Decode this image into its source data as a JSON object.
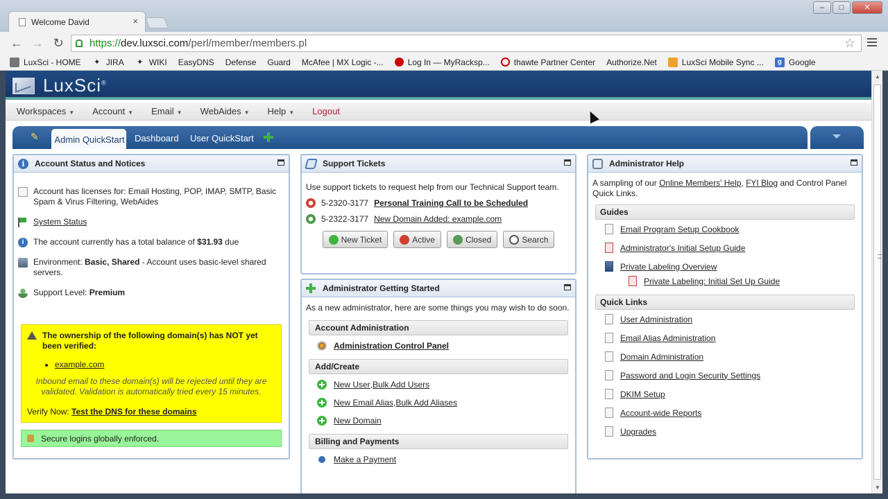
{
  "browser": {
    "tab_title": "Welcome David",
    "tab_close": "×",
    "url_scheme": "https://",
    "url_host": "dev.luxsci.com",
    "url_path": "/perl/member/members.pl",
    "window_controls": {
      "minimize": "–",
      "maximize": "□",
      "close": "✕"
    },
    "bookmarks": [
      {
        "label": "LuxSci - HOME",
        "icon": "page-icon"
      },
      {
        "label": "JIRA",
        "icon": "jira-icon"
      },
      {
        "label": "WIKI",
        "icon": "wiki-icon"
      },
      {
        "label": "EasyDNS",
        "icon": "page-icon"
      },
      {
        "label": "Defense",
        "icon": "page-icon"
      },
      {
        "label": "Guard",
        "icon": "page-icon"
      },
      {
        "label": "McAfee | MX Logic -...",
        "icon": "page-icon"
      },
      {
        "label": "Log In — MyRacksp...",
        "icon": "rackspace-icon"
      },
      {
        "label": "thawte Partner Center",
        "icon": "thawte-icon"
      },
      {
        "label": "Authorize.Net",
        "icon": "page-icon"
      },
      {
        "label": "LuxSci Mobile Sync ...",
        "icon": "luxsci-icon"
      },
      {
        "label": "Google",
        "icon": "google-icon"
      }
    ]
  },
  "app": {
    "logo": "LuxSci",
    "logo_mark": "®",
    "menu": [
      {
        "label": "Workspaces",
        "caret": true
      },
      {
        "label": "Account",
        "caret": true
      },
      {
        "label": "Email",
        "caret": true
      },
      {
        "label": "WebAides",
        "caret": true
      },
      {
        "label": "Help",
        "caret": true
      },
      {
        "label": "Logout",
        "caret": false
      }
    ],
    "quick_tabs": {
      "active": "Admin QuickStart",
      "dashboard": "Dashboard",
      "user": "User QuickStart"
    }
  },
  "account_panel": {
    "title": "Account Status and Notices",
    "licenses": "Account has licenses for: Email Hosting, POP, IMAP, SMTP, Basic Spam & Virus Filtering, WebAides",
    "system_status": "System Status",
    "balance_prefix": "The account currently has a total balance of ",
    "balance_value": "$31.93",
    "balance_suffix": " due",
    "env_prefix": "Environment: ",
    "env_value": "Basic, Shared",
    "env_suffix": " - Account uses basic-level shared servers.",
    "support_prefix": "Support Level: ",
    "support_value": "Premium",
    "warning_title": "The ownership of the following domain(s) has NOT yet been verified:",
    "warning_domain": "example.com",
    "warning_note": "Inbound email to these domain(s) will be rejected until they are validated. Validation is automatically tried every 15 minutes.",
    "verify_prefix": "Verify Now: ",
    "verify_link": "Test the DNS for these domains",
    "secure": "Secure logins globally enforced."
  },
  "tickets_panel": {
    "title": "Support Tickets",
    "intro": "Use support tickets to request help from our Technical Support team.",
    "tickets": [
      {
        "number": "5-2320-3177",
        "subject": "Personal Training Call to be Scheduled",
        "bold": true
      },
      {
        "number": "5-2322-3177",
        "subject": "New Domain Added: example.com",
        "bold": false
      }
    ],
    "buttons": {
      "new": "New Ticket",
      "active": "Active",
      "closed": "Closed",
      "search": "Search"
    }
  },
  "getting_started": {
    "title": "Administrator Getting Started",
    "intro": "As a new administrator, here are some things you may wish to do soon.",
    "account_admin_header": "Account Administration",
    "admin_control_panel": "Administration Control Panel",
    "add_create_header": "Add/Create",
    "new_user": "New User",
    "bulk_add_users": "Bulk Add Users",
    "new_email_alias": "New Email Alias",
    "bulk_add_aliases": "Bulk Add Aliases",
    "new_domain": "New Domain",
    "billing_header": "Billing and Payments",
    "make_payment": "Make a Payment",
    "separator": ", "
  },
  "help_panel": {
    "title": "Administrator Help",
    "intro_prefix": "A sampling of our ",
    "intro_link1": "Online Members' Help",
    "intro_sep": ", ",
    "intro_link2": "FYI Blog",
    "intro_suffix": " and Control Panel Quick Links.",
    "guides_header": "Guides",
    "guides": [
      {
        "label": "Email Program Setup Cookbook",
        "icon": "doc"
      },
      {
        "label": "Administrator's Initial Setup Guide",
        "icon": "pdf"
      },
      {
        "label": "Private Labeling Overview",
        "icon": "book"
      }
    ],
    "sub_guide": "Private Labeling: Initial Set Up Guide",
    "quick_links_header": "Quick Links",
    "quick_links": [
      "User Administration",
      "Email Alias Administration",
      "Domain Administration",
      "Password and Login Security Settings",
      "DKIM Setup",
      "Account-wide Reports",
      "Upgrades"
    ]
  }
}
